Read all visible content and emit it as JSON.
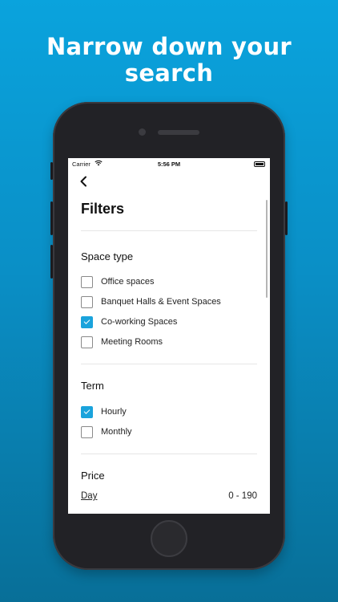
{
  "headline": "Narrow down your search",
  "status_bar": {
    "carrier": "Carrier",
    "time": "5:56 PM"
  },
  "screen": {
    "back_glyph": "‹",
    "title": "Filters",
    "sections": {
      "space_type": {
        "title": "Space type",
        "options": [
          {
            "label": "Office spaces",
            "checked": false
          },
          {
            "label": "Banquet Halls & Event Spaces",
            "checked": false
          },
          {
            "label": "Co-working Spaces",
            "checked": true
          },
          {
            "label": "Meeting Rooms",
            "checked": false
          }
        ]
      },
      "term": {
        "title": "Term",
        "options": [
          {
            "label": "Hourly",
            "checked": true
          },
          {
            "label": "Monthly",
            "checked": false
          }
        ]
      },
      "price": {
        "title": "Price",
        "period_label": "Day",
        "range": "0 - 190"
      }
    }
  },
  "colors": {
    "accent": "#1aa3dc",
    "background_top": "#0aa3dd",
    "background_bottom": "#086f98"
  },
  "icons": {
    "back": "chevron-left-icon",
    "wifi": "wifi-icon",
    "battery": "battery-icon",
    "check": "check-icon"
  }
}
